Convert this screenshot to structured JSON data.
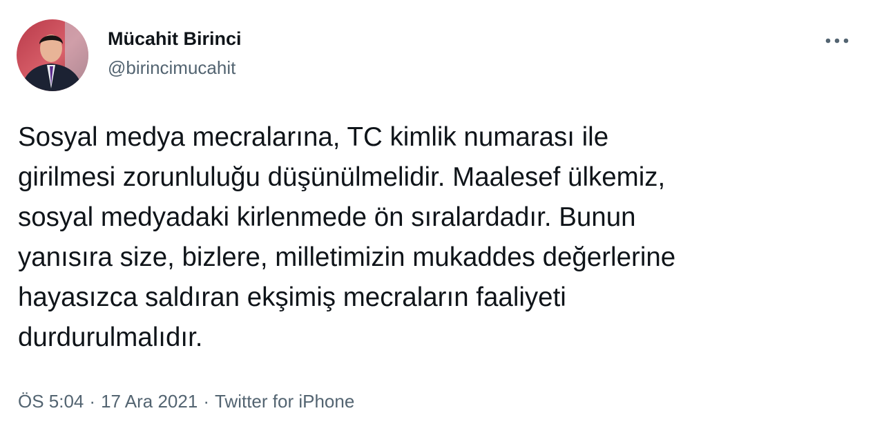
{
  "author": {
    "display_name": "Mücahit Birinci",
    "handle": "@birincimucahit"
  },
  "icons": {
    "more": "more-horizontal-icon",
    "avatar": "profile-photo"
  },
  "tweet": {
    "text": "Sosyal medya mecralarına, TC kimlik numarası ile\ngirilmesi zorunluluğu düşünülmelidir. Maalesef ülkemiz,\nsosyal medyadaki kirlenmede ön sıralardadır. Bunun\nyanısıra size, bizlere, milletimizin mukaddes değerlerine\nhayasızca saldıran ekşimiş mecraların faaliyeti\ndurdurulmalıdır.",
    "time": "ÖS 5:04",
    "date": "17 Ara 2021",
    "source": "Twitter for iPhone",
    "separator": "·"
  },
  "colors": {
    "text_primary": "#0f1419",
    "text_secondary": "#536471"
  }
}
